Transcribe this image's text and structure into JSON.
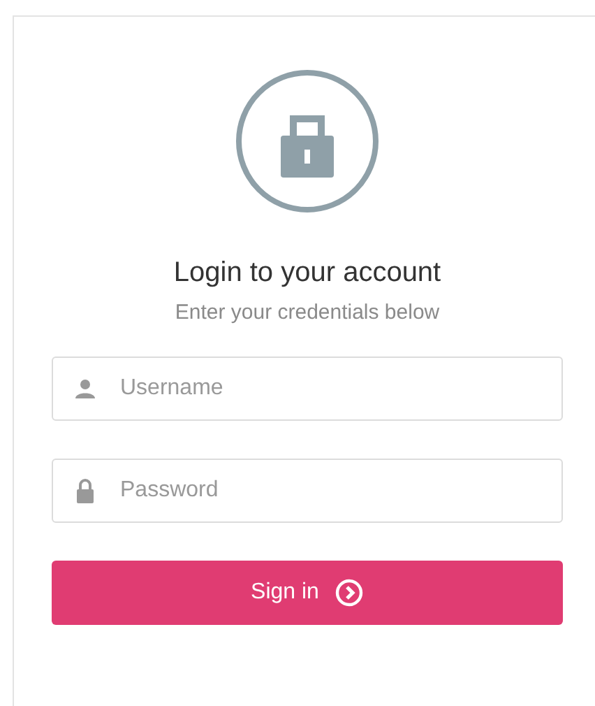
{
  "title": "Login to your account",
  "subtitle": "Enter your credentials below",
  "fields": [
    {
      "kind": "user",
      "placeholder": "Username"
    },
    {
      "kind": "lock",
      "placeholder": "Password"
    }
  ],
  "submit": {
    "label": "Sign in"
  }
}
